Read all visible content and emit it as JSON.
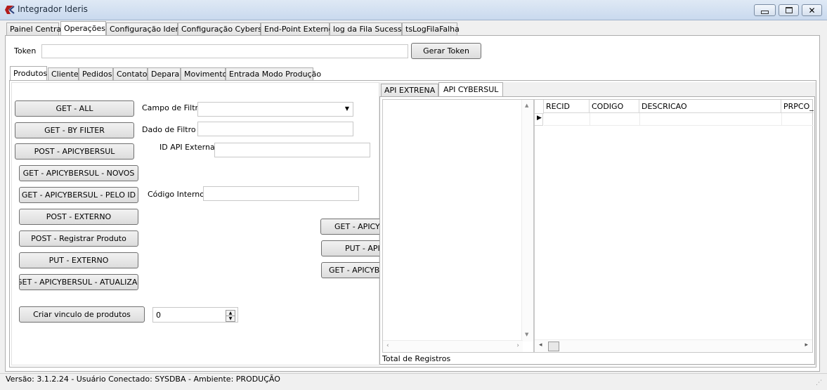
{
  "window": {
    "title": "Integrador Ideris"
  },
  "main_tabs": [
    {
      "label": "Painel Central"
    },
    {
      "label": "Operações"
    },
    {
      "label": "Configuração Ideris"
    },
    {
      "label": "Configuração Cybersul"
    },
    {
      "label": "End-Point Externo"
    },
    {
      "label": "log da Fila Sucesso"
    },
    {
      "label": "tsLogFilaFalha"
    }
  ],
  "token": {
    "label": "Token",
    "value": "",
    "generate_button": "Gerar Token"
  },
  "sub_tabs": [
    {
      "label": "Produtos"
    },
    {
      "label": "Cliente"
    },
    {
      "label": "Pedidos"
    },
    {
      "label": "Contato"
    },
    {
      "label": "Depara"
    },
    {
      "label": "Movimento"
    },
    {
      "label": "Entrada Modo Produção"
    }
  ],
  "produtos": {
    "buttons": {
      "get_all": "GET - ALL",
      "get_by_filter": "GET - BY FILTER",
      "post_apicybersul": "POST - APICYBERSUL",
      "get_apicybersul_novos": "GET - APICYBERSUL - NOVOS",
      "get_apicybersul_pelo_id": "GET - APICYBERSUL - PELO ID",
      "post_externo": "POST - EXTERNO",
      "post_registrar_produto": "POST - Registrar Produto",
      "put_externo": "PUT - EXTERNO",
      "get_apicybersul_atualizar": "GET - APICYBERSUL - ATUALIZAR",
      "criar_vinculo": "Criar vinculo de produtos",
      "get_apicy_partial": "GET - APICYI",
      "put_api_partial": "PUT - API",
      "get_apicybe_partial": "GET - APICYBE"
    },
    "labels": {
      "campo_filtro": "Campo de Filtro",
      "dado_filtro": "Dado de Filtro",
      "id_api_externa": "ID API Externa",
      "codigo_interno": "Código Interno"
    },
    "values": {
      "campo_filtro": "",
      "dado_filtro": "",
      "id_api_externa": "",
      "codigo_interno": "",
      "vinculo_spin": "0"
    }
  },
  "right_tabs": [
    {
      "label": "API EXTRENA"
    },
    {
      "label": "API CYBERSUL"
    }
  ],
  "grid": {
    "columns": [
      "RECID",
      "CODIGO",
      "DESCRICAO",
      "PRPCO_"
    ],
    "footer": "Total de Registros"
  },
  "status": {
    "text": "Versão: 3.1.2.24  - Usuário Conectado: SYSDBA  - Ambiente: PRODUÇÃO"
  },
  "colors": {
    "title_bar": "#c9d9ee",
    "window_bg": "#f0f0f0",
    "border": "#adadad"
  }
}
